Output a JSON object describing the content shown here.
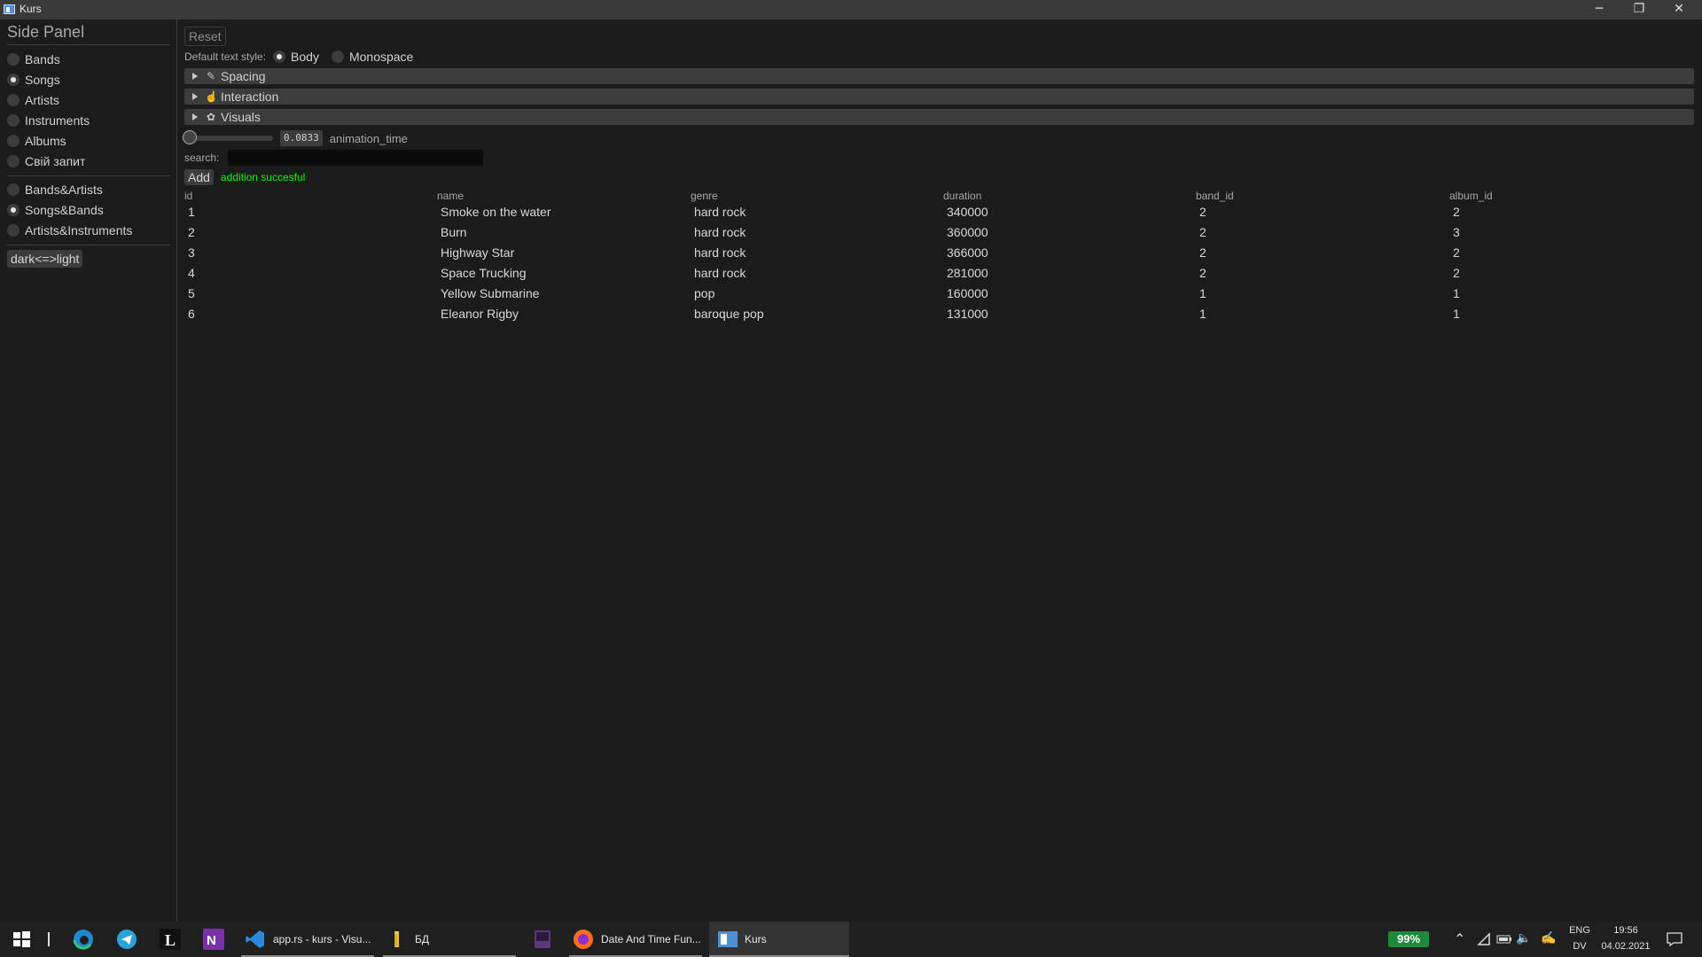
{
  "window": {
    "title": "Kurs",
    "minimize_icon": "minimize-icon",
    "restore_icon": "restore-icon",
    "close_icon": "close-icon"
  },
  "side_panel": {
    "heading": "Side Panel",
    "group1": [
      {
        "label": "Bands",
        "selected": false
      },
      {
        "label": "Songs",
        "selected": true
      },
      {
        "label": "Artists",
        "selected": false
      },
      {
        "label": "Instruments",
        "selected": false
      },
      {
        "label": "Albums",
        "selected": false
      },
      {
        "label": "Свій запит",
        "selected": false
      }
    ],
    "group2": [
      {
        "label": "Bands&Artists",
        "selected": false
      },
      {
        "label": "Songs&Bands",
        "selected": true
      },
      {
        "label": "Artists&Instruments",
        "selected": false
      }
    ],
    "theme_button": "dark<=>light"
  },
  "main": {
    "reset_label": "Reset",
    "text_style": {
      "label": "Default text style:",
      "options": [
        {
          "label": "Body",
          "selected": true
        },
        {
          "label": "Monospace",
          "selected": false
        }
      ]
    },
    "sections": [
      {
        "label": "Spacing",
        "icon": "pencil-icon"
      },
      {
        "label": "Interaction",
        "icon": "hand-icon"
      },
      {
        "label": "Visuals",
        "icon": "palette-icon"
      }
    ],
    "slider": {
      "value": "0.0833",
      "label": "animation_time",
      "fraction": 0.0
    },
    "search": {
      "label": "search:",
      "value": "",
      "placeholder": ""
    },
    "add_label": "Add",
    "status_message": "addition succesful",
    "table": {
      "columns": [
        "id",
        "name",
        "genre",
        "duration",
        "band_id",
        "album_id"
      ],
      "rows": [
        [
          "1",
          "Smoke on the water",
          "hard rock",
          "340000",
          "2",
          "2"
        ],
        [
          "2",
          "Burn",
          "hard rock",
          "360000",
          "2",
          "3"
        ],
        [
          "3",
          "Highway Star",
          "hard rock",
          "366000",
          "2",
          "2"
        ],
        [
          "4",
          "Space Trucking",
          "hard rock",
          "281000",
          "2",
          "2"
        ],
        [
          "5",
          "Yellow Submarine",
          "pop",
          "160000",
          "1",
          "1"
        ],
        [
          "6",
          "Eleanor Rigby",
          "baroque pop",
          "131000",
          "1",
          "1"
        ]
      ]
    }
  },
  "taskbar": {
    "apps": [
      {
        "label": "app.rs - kurs - Visu...",
        "icon": "vscode-icon"
      },
      {
        "label": "БД",
        "icon": "folder-icon"
      },
      {
        "label": "",
        "icon": "app-icon"
      },
      {
        "label": "Date And Time Fun...",
        "icon": "firefox-icon"
      },
      {
        "label": "Kurs",
        "icon": "kurs-window-icon"
      }
    ],
    "battery": "99%",
    "language_top": "ENG",
    "language_bottom": "DV",
    "time": "19:56",
    "date": "04.02.2021"
  }
}
